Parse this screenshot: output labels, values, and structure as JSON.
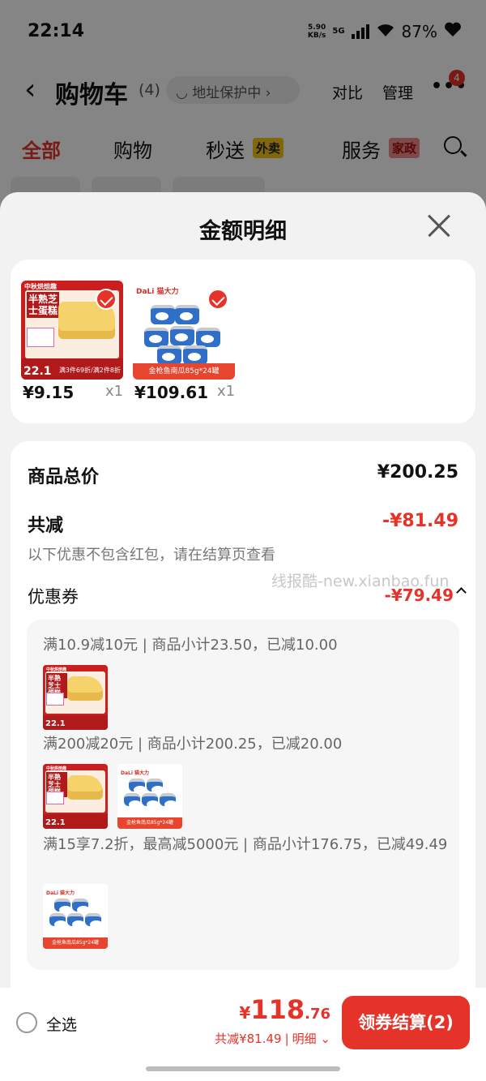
{
  "status_bar": {
    "time": "22:14",
    "net_speed_value": "5.90",
    "net_speed_unit": "KB/s",
    "network": "5G",
    "battery": "87%"
  },
  "cart_header": {
    "title": "购物车",
    "count": "(4)",
    "address": "地址保护中",
    "compare": "对比",
    "manage": "管理",
    "more_badge": "4"
  },
  "category_tabs": [
    {
      "label": "全部"
    },
    {
      "label": "购物"
    },
    {
      "label": "秒送",
      "tag": "外卖"
    },
    {
      "label": "服务",
      "tag": "家政"
    }
  ],
  "sheet": {
    "title": "金额明细"
  },
  "products": [
    {
      "price": "¥9.15",
      "qty": "x1",
      "badge": "22.1",
      "label": "半熟芝士蛋糕",
      "promo": "满3件69折/满2件8折",
      "brand": "中秋烘焙趣"
    },
    {
      "price": "¥109.61",
      "qty": "x1",
      "brand": "DaLi 猫大力",
      "band": "金枪鱼南瓜85g*24罐"
    }
  ],
  "summary": {
    "total_label": "商品总价",
    "total_value": "¥200.25",
    "discount_label": "共减",
    "discount_value": "-¥81.49",
    "note": "以下优惠不包含红包，请在结算页查看",
    "watermark": "线报酷-new.xianbao.fun",
    "coupon_label": "优惠券",
    "coupon_value": "-¥79.49"
  },
  "coupon_rules": [
    "满10.9减10元 | 商品小计23.50，已减10.00",
    "满200减20元 | 商品小计200.25，已减20.00",
    "满15享7.2折，最高减5000元 | 商品小计176.75，已减49.49"
  ],
  "bottom_bar": {
    "select_all": "全选",
    "currency": "¥",
    "total_int": "118",
    "total_dec": ".76",
    "saved": "共减¥81.49",
    "sep": "|",
    "detail": "明细",
    "checkout": "领券结算(2)"
  },
  "colors": {
    "accent": "#e6332a",
    "tag_waimai": "#f5c518",
    "sheet_bg": "#f2f2f2"
  }
}
